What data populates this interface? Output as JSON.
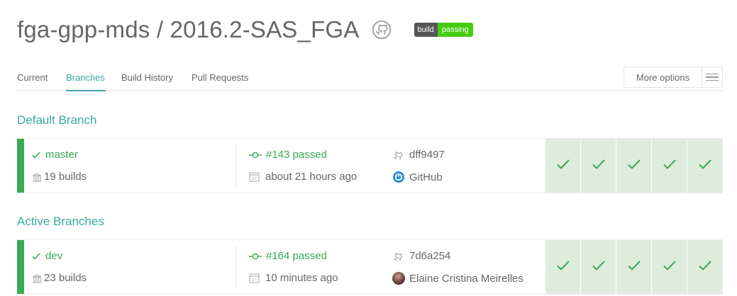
{
  "header": {
    "repo_title": "fga-gpp-mds / 2016.2-SAS_FGA",
    "badge_left": "build",
    "badge_right": "passing"
  },
  "tabs": [
    {
      "label": "Current"
    },
    {
      "label": "Branches",
      "active": true
    },
    {
      "label": "Build History"
    },
    {
      "label": "Pull Requests"
    }
  ],
  "more_options_label": "More options",
  "sections": {
    "default_title": "Default Branch",
    "active_title": "Active Branches"
  },
  "branches": [
    {
      "name": "master",
      "builds": "19 builds",
      "build_status": "#143 passed",
      "time": "about 21 hours ago",
      "commit": "dff9497",
      "author": "GitHub",
      "jobs": [
        "passed",
        "passed",
        "passed",
        "passed",
        "passed"
      ]
    },
    {
      "name": "dev",
      "builds": "23 builds",
      "build_status": "#164 passed",
      "time": "10 minutes ago",
      "commit": "7d6a254",
      "author": "Elaine Cristina Meirelles",
      "jobs": [
        "passed",
        "passed",
        "passed",
        "passed",
        "passed"
      ]
    }
  ],
  "colors": {
    "passed": "#39aa56",
    "accent": "#39aaa4",
    "job_bg": "#deecdc"
  },
  "icons": {
    "github": "github-octocat-icon",
    "branch_status": "check-icon",
    "builds": "building-icon",
    "build_number": "commit-node-icon",
    "calendar": "calendar-icon",
    "commit": "github-octocat-icon",
    "author_github": "github-power-icon",
    "job_status": "check-icon"
  }
}
